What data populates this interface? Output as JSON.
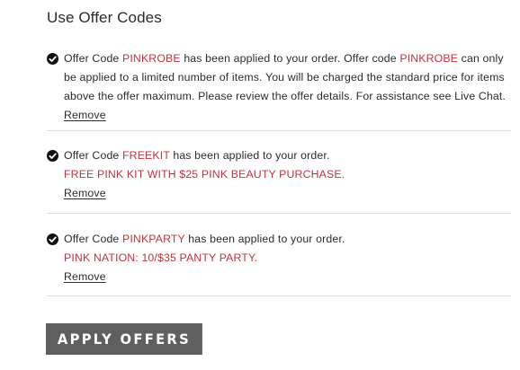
{
  "section": {
    "title": "Use Offer Codes"
  },
  "offers": [
    {
      "prefix": "Offer Code ",
      "code": "PINKROBE",
      "applied_text": " has been applied to your order. Offer code ",
      "code_repeat": "PINKROBE",
      "notice": " can only be applied to a limited number of items. You will be charged the standard price for items above the offer maximum. Please review the offer details. For assistance see Live Chat.",
      "remove_label": "Remove",
      "icon": "check-circle-icon"
    },
    {
      "prefix": "Offer Code ",
      "code": "FREEKIT",
      "applied_text": " has been applied to your order.",
      "detail": "FREE PINK KIT WITH $25 PINK BEAUTY PURCHASE.",
      "remove_label": "Remove",
      "icon": "check-circle-icon"
    },
    {
      "prefix": "Offer Code ",
      "code": "PINKPARTY",
      "applied_text": " has been applied to your order.",
      "detail": "PINK NATION: 10/$35 PANTY PARTY.",
      "remove_label": "Remove",
      "icon": "check-circle-icon"
    }
  ],
  "apply_button": {
    "label": "APPLY OFFERS"
  },
  "colors": {
    "code_accent": "#c0343f",
    "button_bg": "#5f5f5f",
    "divider": "#dcdcdc"
  }
}
